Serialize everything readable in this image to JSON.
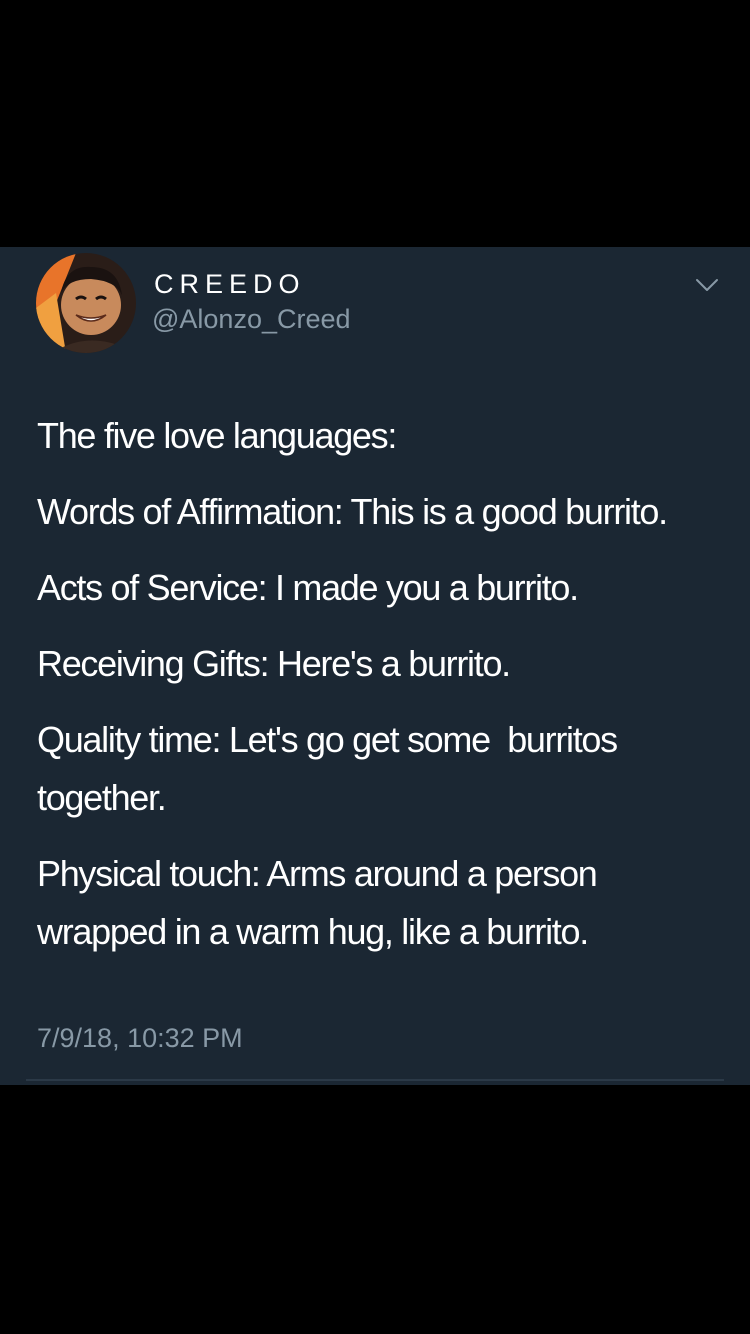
{
  "author": {
    "display_name": "CREEDO",
    "handle": "@Alonzo_Creed",
    "avatar_icon": "profile-photo"
  },
  "menu": {
    "icon": "chevron-down-icon"
  },
  "tweet": {
    "lines": [
      "The five love languages:",
      "Words of Affirmation: This is a good burrito.",
      "Acts of Service: I made you a burrito.",
      "Receiving Gifts: Here's a burrito.",
      "Quality time: Let's go get some  burritos together.",
      "Physical touch: Arms around a person wrapped in a warm hug, like a burrito."
    ],
    "timestamp": "7/9/18, 10:32 PM"
  },
  "colors": {
    "background": "#1b2733",
    "primary_text": "#ffffff",
    "secondary_text": "#8899a6",
    "outer": "#000000"
  }
}
